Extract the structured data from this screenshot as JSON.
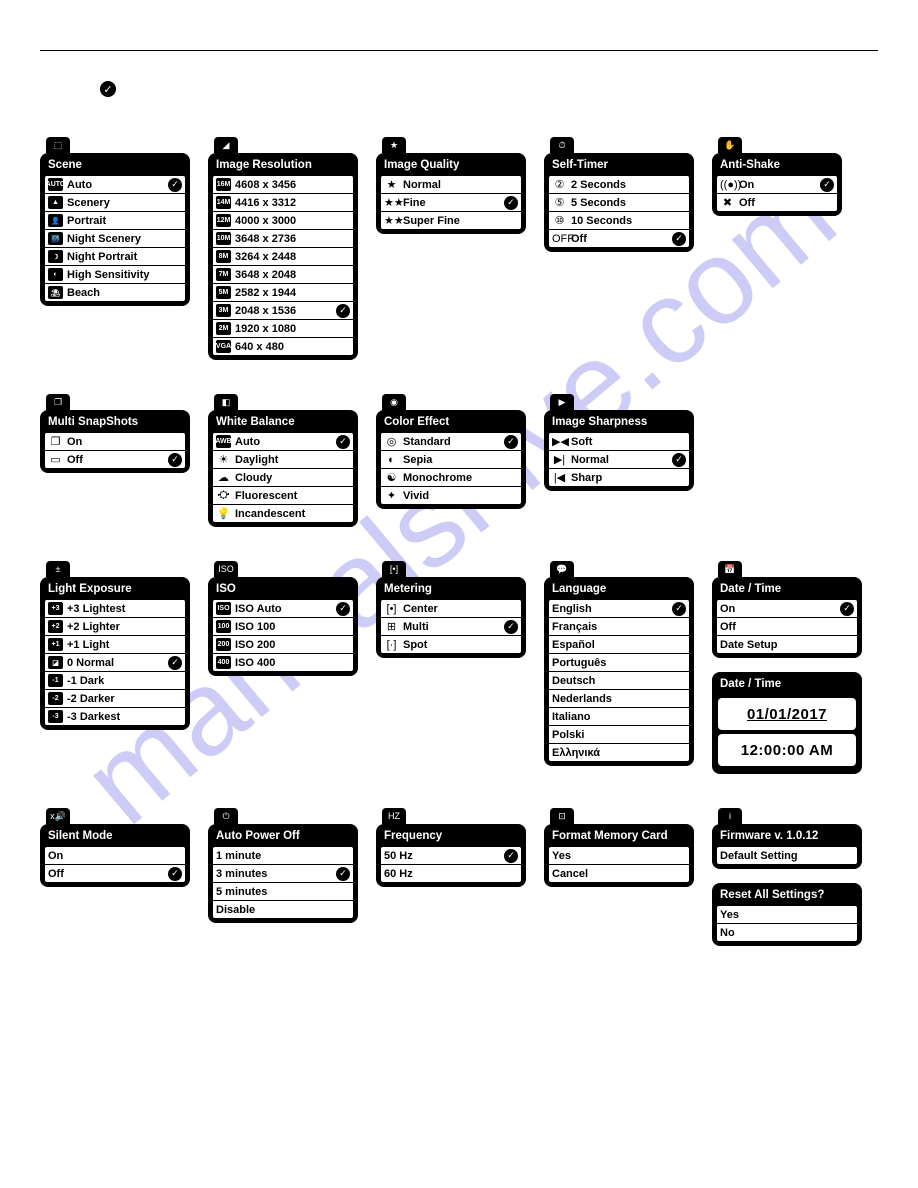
{
  "menus": {
    "scene": {
      "title": "Scene",
      "items": [
        {
          "icon": "AUTO",
          "label": "Auto",
          "checked": true
        },
        {
          "icon": "▲",
          "label": "Scenery"
        },
        {
          "icon": "👤",
          "label": "Portrait"
        },
        {
          "icon": "🌃",
          "label": "Night Scenery"
        },
        {
          "icon": "☽",
          "label": "Night Portrait"
        },
        {
          "icon": "◐",
          "label": "High Sensitivity"
        },
        {
          "icon": "⛱",
          "label": "Beach"
        }
      ]
    },
    "resolution": {
      "title": "Image Resolution",
      "items": [
        {
          "icon": "16M",
          "label": "4608 x 3456"
        },
        {
          "icon": "14M",
          "label": "4416 x 3312"
        },
        {
          "icon": "12M",
          "label": "4000 x 3000"
        },
        {
          "icon": "10M",
          "label": "3648 x 2736"
        },
        {
          "icon": "8M",
          "label": "3264 x 2448"
        },
        {
          "icon": "7M",
          "label": "3648 x 2048"
        },
        {
          "icon": "5M",
          "label": "2582 x 1944"
        },
        {
          "icon": "3M",
          "label": "2048 x 1536",
          "checked": true
        },
        {
          "icon": "2M",
          "label": "1920 x 1080"
        },
        {
          "icon": "VGA",
          "label": "640 x 480"
        }
      ]
    },
    "quality": {
      "title": "Image Quality",
      "items": [
        {
          "sym": "★",
          "label": "Normal"
        },
        {
          "sym": "★★",
          "label": "Fine",
          "checked": true
        },
        {
          "sym": "★★",
          "label": "Super Fine"
        }
      ]
    },
    "timer": {
      "title": "Self-Timer",
      "items": [
        {
          "sym": "②",
          "label": "2 Seconds"
        },
        {
          "sym": "⑤",
          "label": "5 Seconds"
        },
        {
          "sym": "⑩",
          "label": "10 Seconds"
        },
        {
          "sym": "OFF",
          "label": "Off",
          "checked": true
        }
      ]
    },
    "antishake": {
      "title": "Anti-Shake",
      "items": [
        {
          "sym": "((●))",
          "label": "On",
          "checked": true
        },
        {
          "sym": "✖",
          "label": "Off"
        }
      ]
    },
    "multisnap": {
      "title": "Multi SnapShots",
      "items": [
        {
          "sym": "❐",
          "label": "On"
        },
        {
          "sym": "▭",
          "label": "Off",
          "checked": true
        }
      ]
    },
    "whitebal": {
      "title": "White Balance",
      "items": [
        {
          "icon": "AWB",
          "label": "Auto",
          "checked": true
        },
        {
          "sym": "☀",
          "label": "Daylight"
        },
        {
          "sym": "☁",
          "label": "Cloudy"
        },
        {
          "sym": "⛮",
          "label": "Fluorescent"
        },
        {
          "sym": "💡",
          "label": "Incandescent"
        }
      ]
    },
    "coloreffect": {
      "title": "Color Effect",
      "items": [
        {
          "sym": "◎",
          "label": "Standard",
          "checked": true
        },
        {
          "sym": "◐",
          "label": "Sepia"
        },
        {
          "sym": "☯",
          "label": "Monochrome"
        },
        {
          "sym": "✦",
          "label": "Vivid"
        }
      ]
    },
    "sharpness": {
      "title": "Image Sharpness",
      "items": [
        {
          "sym": "▶◀",
          "label": "Soft"
        },
        {
          "sym": "▶|",
          "label": "Normal",
          "checked": true
        },
        {
          "sym": "|◀",
          "label": "Sharp"
        }
      ]
    },
    "exposure": {
      "title": "Light Exposure",
      "items": [
        {
          "icon": "+3",
          "label": "+3 Lightest"
        },
        {
          "icon": "+2",
          "label": "+2 Lighter"
        },
        {
          "icon": "+1",
          "label": "+1 Light"
        },
        {
          "icon": "◪",
          "label": "0 Normal",
          "checked": true
        },
        {
          "icon": "-1",
          "label": "-1 Dark"
        },
        {
          "icon": "-2",
          "label": "-2 Darker"
        },
        {
          "icon": "-3",
          "label": "-3 Darkest"
        }
      ]
    },
    "iso": {
      "title": "ISO",
      "items": [
        {
          "icon": "ISO",
          "label": "ISO Auto",
          "checked": true
        },
        {
          "icon": "100",
          "label": "ISO 100"
        },
        {
          "icon": "200",
          "label": "ISO 200"
        },
        {
          "icon": "400",
          "label": "ISO 400"
        }
      ]
    },
    "metering": {
      "title": "Metering",
      "items": [
        {
          "sym": "[•]",
          "label": "Center"
        },
        {
          "sym": "⊞",
          "label": "Multi",
          "checked": true
        },
        {
          "sym": "[·]",
          "label": "Spot"
        }
      ]
    },
    "language": {
      "title": "Language",
      "items": [
        {
          "label": "English",
          "checked": true
        },
        {
          "label": "Français"
        },
        {
          "label": "Español"
        },
        {
          "label": "Português"
        },
        {
          "label": "Deutsch"
        },
        {
          "label": "Nederlands"
        },
        {
          "label": "Italiano"
        },
        {
          "label": "Polski"
        },
        {
          "label": "Ελληνικά"
        }
      ]
    },
    "datetime": {
      "title": "Date / Time",
      "items": [
        {
          "label": "On",
          "checked": true
        },
        {
          "label": "Off"
        },
        {
          "label": "Date Setup"
        }
      ]
    },
    "datesetup": {
      "title": "Date / Time",
      "date": "01/01/2017",
      "time": "12:00:00 AM"
    },
    "silent": {
      "title": "Silent Mode",
      "items": [
        {
          "label": "On"
        },
        {
          "label": "Off",
          "checked": true
        }
      ]
    },
    "autopower": {
      "title": "Auto Power Off",
      "items": [
        {
          "label": "1 minute"
        },
        {
          "label": "3 minutes",
          "checked": true
        },
        {
          "label": "5 minutes"
        },
        {
          "label": "Disable"
        }
      ]
    },
    "frequency": {
      "title": "Frequency",
      "items": [
        {
          "label": "50 Hz",
          "checked": true
        },
        {
          "label": "60 Hz"
        }
      ]
    },
    "format": {
      "title": "Format Memory Card",
      "items": [
        {
          "label": "Yes"
        },
        {
          "label": "Cancel"
        }
      ]
    },
    "firmware": {
      "title": "Firmware v. 1.0.12",
      "items": [
        {
          "label": "Default Setting"
        }
      ]
    },
    "reset": {
      "title": "Reset All Settings?",
      "items": [
        {
          "label": "Yes"
        },
        {
          "label": "No"
        }
      ]
    }
  }
}
